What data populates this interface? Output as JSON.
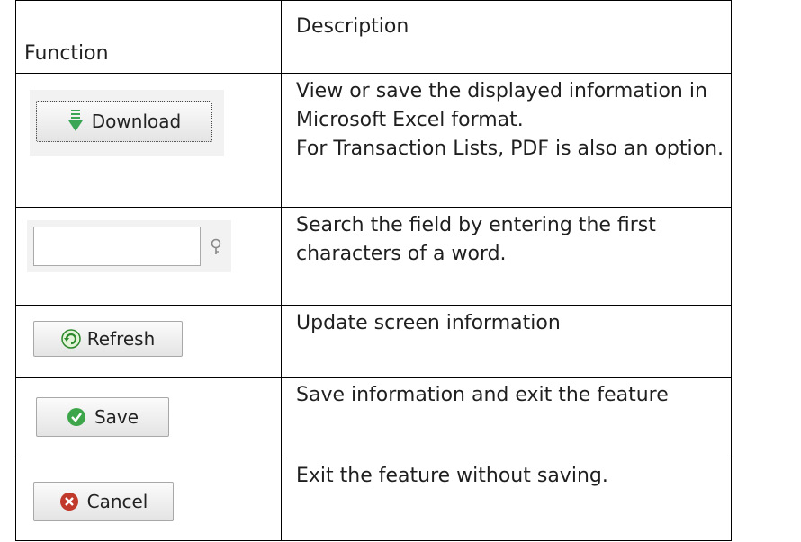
{
  "header": {
    "function_label": "Function",
    "description_label": "Description"
  },
  "rows": [
    {
      "button_label": "Download",
      "button_icon": "download-arrow-icon",
      "description_lines": [
        "View or save the displayed information in",
        "Microsoft Excel format.",
        "For Transaction Lists, PDF is also an option."
      ]
    },
    {
      "button_icon": "search-filter-icon",
      "description_lines": [
        "Search the field by entering the first",
        "characters of a word."
      ]
    },
    {
      "button_label": "Refresh",
      "button_icon": "refresh-icon",
      "description_lines": [
        "Update screen information"
      ]
    },
    {
      "button_label": "Save",
      "button_icon": "check-circle-icon",
      "description_lines": [
        "Save information and exit the feature"
      ]
    },
    {
      "button_label": "Cancel",
      "button_icon": "cancel-circle-icon",
      "description_lines": [
        "Exit the feature without saving."
      ]
    }
  ],
  "colors": {
    "download_arrow": "#3aa655",
    "refresh_icon": "#2d8a2d",
    "save_icon": "#3ea64a",
    "cancel_icon": "#c0392b"
  }
}
